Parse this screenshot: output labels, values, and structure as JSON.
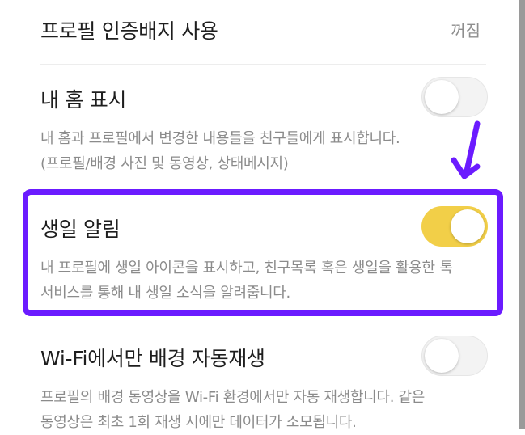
{
  "settings": {
    "badge": {
      "title": "프로필 인증배지 사용",
      "value": "꺼짐"
    },
    "home_display": {
      "title": "내 홈 표시",
      "enabled": false,
      "desc_line1": "내 홈과 프로필에서 변경한 내용들을 친구들에게 표시합니다.",
      "desc_line2": "(프로필/배경 사진 및 동영상, 상태메시지)"
    },
    "birthday": {
      "title": "생일 알림",
      "enabled": true,
      "desc_line1": "내 프로필에 생일 아이콘을 표시하고, 친구목록 혹은 생일을 활용한 톡",
      "desc_line2": "서비스를 통해 내 생일 소식을 알려줍니다."
    },
    "wifi_bg": {
      "title": "Wi-Fi에서만 배경 자동재생",
      "enabled": false,
      "desc_line1": "프로필의 배경 동영상을 Wi-Fi 환경에서만 자동 재생합니다. 같은",
      "desc_line2": "동영상은 최초 1회 재생 시에만 데이터가 소모됩니다."
    }
  },
  "colors": {
    "toggle_on": "#f2cf48",
    "toggle_off": "#f3f3f3",
    "annotation": "#6b1bff"
  },
  "icons": {
    "annotation_arrow": "arrow-down-icon"
  }
}
